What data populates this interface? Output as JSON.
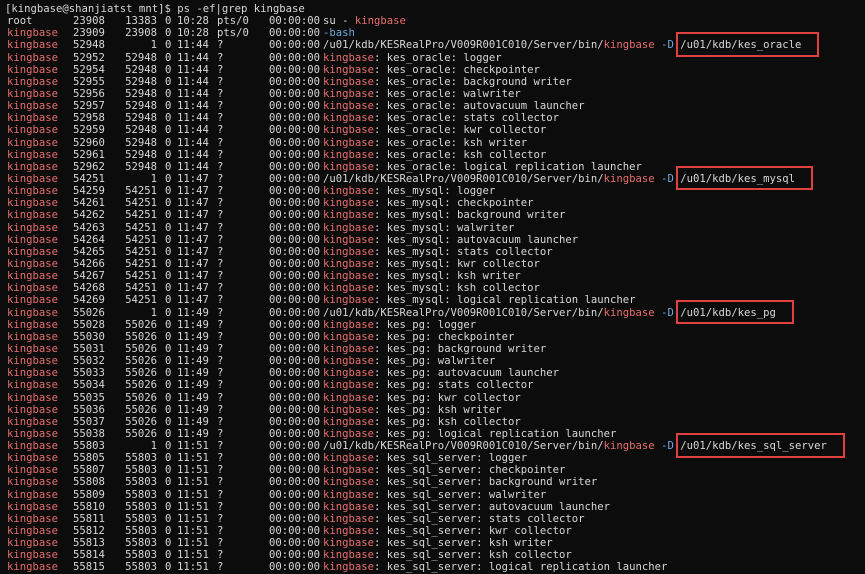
{
  "prompt": "[kingbase@shanjiatst mnt]$ ps -ef|grep kingbase",
  "keyword": "kingbase",
  "colors": {
    "background": "#0c0c0c",
    "text": "#d7d7d7",
    "match": "#e76e6e",
    "bash": "#6fa8dc",
    "highlight": "#e0413e"
  },
  "processes": [
    {
      "user": "root",
      "pid": "23908",
      "ppid": "13383",
      "c": "0",
      "stime": "10:28",
      "tty": "pts/0",
      "time": "00:00:00",
      "cmd": "su - kingbase"
    },
    {
      "user": "kingbase",
      "pid": "23909",
      "ppid": "23908",
      "c": "0",
      "stime": "10:28",
      "tty": "pts/0",
      "time": "00:00:00",
      "cmd": "-bash"
    },
    {
      "user": "kingbase",
      "pid": "52948",
      "ppid": "1",
      "c": "0",
      "stime": "11:44",
      "tty": "?",
      "time": "00:00:00",
      "cmd": "/u01/kdb/KESRealPro/V009R001C010/Server/bin/kingbase -D /u01/kdb/kes_oracle"
    },
    {
      "user": "kingbase",
      "pid": "52952",
      "ppid": "52948",
      "c": "0",
      "stime": "11:44",
      "tty": "?",
      "time": "00:00:00",
      "cmd": "kingbase: kes_oracle: logger"
    },
    {
      "user": "kingbase",
      "pid": "52954",
      "ppid": "52948",
      "c": "0",
      "stime": "11:44",
      "tty": "?",
      "time": "00:00:00",
      "cmd": "kingbase: kes_oracle: checkpointer"
    },
    {
      "user": "kingbase",
      "pid": "52955",
      "ppid": "52948",
      "c": "0",
      "stime": "11:44",
      "tty": "?",
      "time": "00:00:00",
      "cmd": "kingbase: kes_oracle: background writer"
    },
    {
      "user": "kingbase",
      "pid": "52956",
      "ppid": "52948",
      "c": "0",
      "stime": "11:44",
      "tty": "?",
      "time": "00:00:00",
      "cmd": "kingbase: kes_oracle: walwriter"
    },
    {
      "user": "kingbase",
      "pid": "52957",
      "ppid": "52948",
      "c": "0",
      "stime": "11:44",
      "tty": "?",
      "time": "00:00:00",
      "cmd": "kingbase: kes_oracle: autovacuum launcher"
    },
    {
      "user": "kingbase",
      "pid": "52958",
      "ppid": "52948",
      "c": "0",
      "stime": "11:44",
      "tty": "?",
      "time": "00:00:00",
      "cmd": "kingbase: kes_oracle: stats collector"
    },
    {
      "user": "kingbase",
      "pid": "52959",
      "ppid": "52948",
      "c": "0",
      "stime": "11:44",
      "tty": "?",
      "time": "00:00:00",
      "cmd": "kingbase: kes_oracle: kwr collector"
    },
    {
      "user": "kingbase",
      "pid": "52960",
      "ppid": "52948",
      "c": "0",
      "stime": "11:44",
      "tty": "?",
      "time": "00:00:00",
      "cmd": "kingbase: kes_oracle: ksh writer"
    },
    {
      "user": "kingbase",
      "pid": "52961",
      "ppid": "52948",
      "c": "0",
      "stime": "11:44",
      "tty": "?",
      "time": "00:00:00",
      "cmd": "kingbase: kes_oracle: ksh collector"
    },
    {
      "user": "kingbase",
      "pid": "52962",
      "ppid": "52948",
      "c": "0",
      "stime": "11:44",
      "tty": "?",
      "time": "00:00:00",
      "cmd": "kingbase: kes_oracle: logical replication launcher"
    },
    {
      "user": "kingbase",
      "pid": "54251",
      "ppid": "1",
      "c": "0",
      "stime": "11:47",
      "tty": "?",
      "time": "00:00:00",
      "cmd": "/u01/kdb/KESRealPro/V009R001C010/Server/bin/kingbase -D /u01/kdb/kes_mysql"
    },
    {
      "user": "kingbase",
      "pid": "54259",
      "ppid": "54251",
      "c": "0",
      "stime": "11:47",
      "tty": "?",
      "time": "00:00:00",
      "cmd": "kingbase: kes_mysql: logger"
    },
    {
      "user": "kingbase",
      "pid": "54261",
      "ppid": "54251",
      "c": "0",
      "stime": "11:47",
      "tty": "?",
      "time": "00:00:00",
      "cmd": "kingbase: kes_mysql: checkpointer"
    },
    {
      "user": "kingbase",
      "pid": "54262",
      "ppid": "54251",
      "c": "0",
      "stime": "11:47",
      "tty": "?",
      "time": "00:00:00",
      "cmd": "kingbase: kes_mysql: background writer"
    },
    {
      "user": "kingbase",
      "pid": "54263",
      "ppid": "54251",
      "c": "0",
      "stime": "11:47",
      "tty": "?",
      "time": "00:00:00",
      "cmd": "kingbase: kes_mysql: walwriter"
    },
    {
      "user": "kingbase",
      "pid": "54264",
      "ppid": "54251",
      "c": "0",
      "stime": "11:47",
      "tty": "?",
      "time": "00:00:00",
      "cmd": "kingbase: kes_mysql: autovacuum launcher"
    },
    {
      "user": "kingbase",
      "pid": "54265",
      "ppid": "54251",
      "c": "0",
      "stime": "11:47",
      "tty": "?",
      "time": "00:00:00",
      "cmd": "kingbase: kes_mysql: stats collector"
    },
    {
      "user": "kingbase",
      "pid": "54266",
      "ppid": "54251",
      "c": "0",
      "stime": "11:47",
      "tty": "?",
      "time": "00:00:00",
      "cmd": "kingbase: kes_mysql: kwr collector"
    },
    {
      "user": "kingbase",
      "pid": "54267",
      "ppid": "54251",
      "c": "0",
      "stime": "11:47",
      "tty": "?",
      "time": "00:00:00",
      "cmd": "kingbase: kes_mysql: ksh writer"
    },
    {
      "user": "kingbase",
      "pid": "54268",
      "ppid": "54251",
      "c": "0",
      "stime": "11:47",
      "tty": "?",
      "time": "00:00:00",
      "cmd": "kingbase: kes_mysql: ksh collector"
    },
    {
      "user": "kingbase",
      "pid": "54269",
      "ppid": "54251",
      "c": "0",
      "stime": "11:47",
      "tty": "?",
      "time": "00:00:00",
      "cmd": "kingbase: kes_mysql: logical replication launcher"
    },
    {
      "user": "kingbase",
      "pid": "55026",
      "ppid": "1",
      "c": "0",
      "stime": "11:49",
      "tty": "?",
      "time": "00:00:00",
      "cmd": "/u01/kdb/KESRealPro/V009R001C010/Server/bin/kingbase -D /u01/kdb/kes_pg"
    },
    {
      "user": "kingbase",
      "pid": "55028",
      "ppid": "55026",
      "c": "0",
      "stime": "11:49",
      "tty": "?",
      "time": "00:00:00",
      "cmd": "kingbase: kes_pg: logger"
    },
    {
      "user": "kingbase",
      "pid": "55030",
      "ppid": "55026",
      "c": "0",
      "stime": "11:49",
      "tty": "?",
      "time": "00:00:00",
      "cmd": "kingbase: kes_pg: checkpointer"
    },
    {
      "user": "kingbase",
      "pid": "55031",
      "ppid": "55026",
      "c": "0",
      "stime": "11:49",
      "tty": "?",
      "time": "00:00:00",
      "cmd": "kingbase: kes_pg: background writer"
    },
    {
      "user": "kingbase",
      "pid": "55032",
      "ppid": "55026",
      "c": "0",
      "stime": "11:49",
      "tty": "?",
      "time": "00:00:00",
      "cmd": "kingbase: kes_pg: walwriter"
    },
    {
      "user": "kingbase",
      "pid": "55033",
      "ppid": "55026",
      "c": "0",
      "stime": "11:49",
      "tty": "?",
      "time": "00:00:00",
      "cmd": "kingbase: kes_pg: autovacuum launcher"
    },
    {
      "user": "kingbase",
      "pid": "55034",
      "ppid": "55026",
      "c": "0",
      "stime": "11:49",
      "tty": "?",
      "time": "00:00:00",
      "cmd": "kingbase: kes_pg: stats collector"
    },
    {
      "user": "kingbase",
      "pid": "55035",
      "ppid": "55026",
      "c": "0",
      "stime": "11:49",
      "tty": "?",
      "time": "00:00:00",
      "cmd": "kingbase: kes_pg: kwr collector"
    },
    {
      "user": "kingbase",
      "pid": "55036",
      "ppid": "55026",
      "c": "0",
      "stime": "11:49",
      "tty": "?",
      "time": "00:00:00",
      "cmd": "kingbase: kes_pg: ksh writer"
    },
    {
      "user": "kingbase",
      "pid": "55037",
      "ppid": "55026",
      "c": "0",
      "stime": "11:49",
      "tty": "?",
      "time": "00:00:00",
      "cmd": "kingbase: kes_pg: ksh collector"
    },
    {
      "user": "kingbase",
      "pid": "55038",
      "ppid": "55026",
      "c": "0",
      "stime": "11:49",
      "tty": "?",
      "time": "00:00:00",
      "cmd": "kingbase: kes_pg: logical replication launcher"
    },
    {
      "user": "kingbase",
      "pid": "55803",
      "ppid": "1",
      "c": "0",
      "stime": "11:51",
      "tty": "?",
      "time": "00:00:00",
      "cmd": "/u01/kdb/KESRealPro/V009R001C010/Server/bin/kingbase -D /u01/kdb/kes_sql_server"
    },
    {
      "user": "kingbase",
      "pid": "55805",
      "ppid": "55803",
      "c": "0",
      "stime": "11:51",
      "tty": "?",
      "time": "00:00:00",
      "cmd": "kingbase: kes_sql_server: logger"
    },
    {
      "user": "kingbase",
      "pid": "55807",
      "ppid": "55803",
      "c": "0",
      "stime": "11:51",
      "tty": "?",
      "time": "00:00:00",
      "cmd": "kingbase: kes_sql_server: checkpointer"
    },
    {
      "user": "kingbase",
      "pid": "55808",
      "ppid": "55803",
      "c": "0",
      "stime": "11:51",
      "tty": "?",
      "time": "00:00:00",
      "cmd": "kingbase: kes_sql_server: background writer"
    },
    {
      "user": "kingbase",
      "pid": "55809",
      "ppid": "55803",
      "c": "0",
      "stime": "11:51",
      "tty": "?",
      "time": "00:00:00",
      "cmd": "kingbase: kes_sql_server: walwriter"
    },
    {
      "user": "kingbase",
      "pid": "55810",
      "ppid": "55803",
      "c": "0",
      "stime": "11:51",
      "tty": "?",
      "time": "00:00:00",
      "cmd": "kingbase: kes_sql_server: autovacuum launcher"
    },
    {
      "user": "kingbase",
      "pid": "55811",
      "ppid": "55803",
      "c": "0",
      "stime": "11:51",
      "tty": "?",
      "time": "00:00:00",
      "cmd": "kingbase: kes_sql_server: stats collector"
    },
    {
      "user": "kingbase",
      "pid": "55812",
      "ppid": "55803",
      "c": "0",
      "stime": "11:51",
      "tty": "?",
      "time": "00:00:00",
      "cmd": "kingbase: kes_sql_server: kwr collector"
    },
    {
      "user": "kingbase",
      "pid": "55813",
      "ppid": "55803",
      "c": "0",
      "stime": "11:51",
      "tty": "?",
      "time": "00:00:00",
      "cmd": "kingbase: kes_sql_server: ksh writer"
    },
    {
      "user": "kingbase",
      "pid": "55814",
      "ppid": "55803",
      "c": "0",
      "stime": "11:51",
      "tty": "?",
      "time": "00:00:00",
      "cmd": "kingbase: kes_sql_server: ksh collector"
    },
    {
      "user": "kingbase",
      "pid": "55815",
      "ppid": "55803",
      "c": "0",
      "stime": "11:51",
      "tty": "?",
      "time": "00:00:00",
      "cmd": "kingbase: kes_sql_server: logical replication launcher"
    }
  ],
  "highlighted_paths": [
    "/u01/kdb/kes_oracle",
    "/u01/kdb/kes_mysql",
    "/u01/kdb/kes_pg",
    "/u01/kdb/kes_sql_server"
  ]
}
